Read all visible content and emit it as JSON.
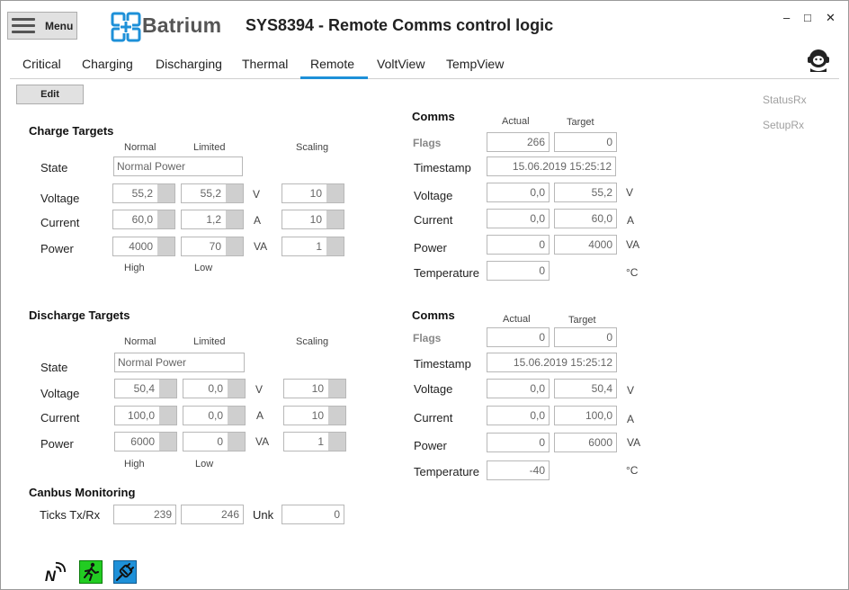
{
  "app": {
    "menu_label": "Menu",
    "logo_text": "Batrium",
    "title": "SYS8394 - Remote Comms control logic"
  },
  "window": {
    "minimize": "–",
    "maximize": "□",
    "close": "✕"
  },
  "tabs": [
    {
      "label": "Critical"
    },
    {
      "label": "Charging"
    },
    {
      "label": "Discharging"
    },
    {
      "label": "Thermal"
    },
    {
      "label": "Remote",
      "active": true
    },
    {
      "label": "VoltView"
    },
    {
      "label": "TempView"
    }
  ],
  "toolbar": {
    "edit_label": "Edit"
  },
  "side_links": {
    "status_rx": "StatusRx",
    "setup_rx": "SetupRx"
  },
  "charge": {
    "title": "Charge Targets",
    "col_normal": "Normal",
    "col_limited": "Limited",
    "col_scaling": "Scaling",
    "state_label": "State",
    "state_value": "Normal Power",
    "voltage_label": "Voltage",
    "voltage_normal": "55,2",
    "voltage_limited": "55,2",
    "voltage_unit": "V",
    "voltage_scaling": "10",
    "current_label": "Current",
    "current_normal": "60,0",
    "current_limited": "1,2",
    "current_unit": "A",
    "current_scaling": "10",
    "power_label": "Power",
    "power_normal": "4000",
    "power_limited": "70",
    "power_unit": "VA",
    "power_scaling": "1",
    "foot_high": "High",
    "foot_low": "Low"
  },
  "discharge": {
    "title": "Discharge Targets",
    "col_normal": "Normal",
    "col_limited": "Limited",
    "col_scaling": "Scaling",
    "state_label": "State",
    "state_value": "Normal Power",
    "voltage_label": "Voltage",
    "voltage_normal": "50,4",
    "voltage_limited": "0,0",
    "voltage_unit": "V",
    "voltage_scaling": "10",
    "current_label": "Current",
    "current_normal": "100,0",
    "current_limited": "0,0",
    "current_unit": "A",
    "current_scaling": "10",
    "power_label": "Power",
    "power_normal": "6000",
    "power_limited": "0",
    "power_unit": "VA",
    "power_scaling": "1",
    "foot_high": "High",
    "foot_low": "Low"
  },
  "comms1": {
    "title": "Comms",
    "col_actual": "Actual",
    "col_target": "Target",
    "flags_label": "Flags",
    "flags_actual": "266",
    "flags_target": "0",
    "timestamp_label": "Timestamp",
    "timestamp_value": "15.06.2019 15:25:12",
    "voltage_label": "Voltage",
    "voltage_actual": "0,0",
    "voltage_target": "55,2",
    "voltage_unit": "V",
    "current_label": "Current",
    "current_actual": "0,0",
    "current_target": "60,0",
    "current_unit": "A",
    "power_label": "Power",
    "power_actual": "0",
    "power_target": "4000",
    "power_unit": "VA",
    "temperature_label": "Temperature",
    "temperature_actual": "0",
    "temperature_unit": "°C"
  },
  "comms2": {
    "title": "Comms",
    "col_actual": "Actual",
    "col_target": "Target",
    "flags_label": "Flags",
    "flags_actual": "0",
    "flags_target": "0",
    "timestamp_label": "Timestamp",
    "timestamp_value": "15.06.2019 15:25:12",
    "voltage_label": "Voltage",
    "voltage_actual": "0,0",
    "voltage_target": "50,4",
    "voltage_unit": "V",
    "current_label": "Current",
    "current_actual": "0,0",
    "current_target": "100,0",
    "current_unit": "A",
    "power_label": "Power",
    "power_actual": "0",
    "power_target": "6000",
    "power_unit": "VA",
    "temperature_label": "Temperature",
    "temperature_actual": "-40",
    "temperature_unit": "°C"
  },
  "canbus": {
    "title": "Canbus Monitoring",
    "ticks_label": "Ticks Tx/Rx",
    "tx": "239",
    "rx": "246",
    "unk_label": "Unk",
    "unk": "0"
  },
  "status_icons": {
    "network": "network-icon",
    "exit": "running-man-icon",
    "plug": "plug-icon",
    "exit_color": "#22cc22",
    "plug_color": "#1e90d8"
  }
}
